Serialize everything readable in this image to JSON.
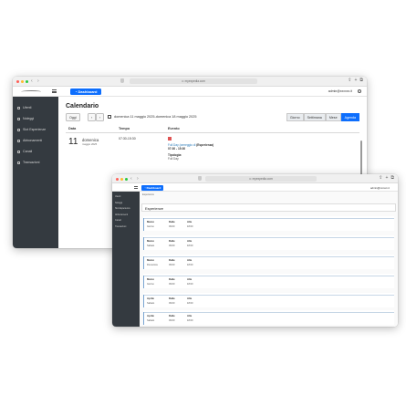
{
  "window1": {
    "url": "⊙ myexpedia.com",
    "dashboard_label": "Dashboard",
    "user_email": "admin@xxxxxx.it",
    "sidebar": [
      {
        "label": "Utenti"
      },
      {
        "label": "Noleggi"
      },
      {
        "label": "Slot Esperienze"
      },
      {
        "label": "Abbonamenti"
      },
      {
        "label": "Canali"
      },
      {
        "label": "Transazioni"
      }
    ],
    "calendar": {
      "title": "Calendario",
      "today_label": "Oggi",
      "range_text": "domenica 11 maggio 2025-domenica 18 maggio 2025",
      "views": [
        "Giorno",
        "Settimana",
        "Mese",
        "Agenda"
      ],
      "active_view": "Agenda",
      "columns": [
        "Data",
        "Tempo",
        "Evento"
      ],
      "day_number": "11",
      "day_name": "domenica",
      "day_sub": "maggio 2025",
      "time": "07:30-15:30",
      "event_link": "Full Day (ormeggio di",
      "event_rest": "(Esperienza)",
      "event_time": "07:30 - 15:30",
      "event_label": "Tipologia:",
      "event_type": "Full Day"
    }
  },
  "window2": {
    "url": "⊙ myexpedia.com",
    "dashboard_label": "Dashboard",
    "user": "admin@xxxxxx.it",
    "breadcrumb": "Esperienze",
    "card_title": "Esperienze",
    "sidebar": [
      {
        "label": "Utenti"
      },
      {
        "label": "Noleggi"
      },
      {
        "label": "Slot Esperienze"
      },
      {
        "label": "Abbonamenti"
      },
      {
        "label": "Canali"
      },
      {
        "label": "Transazioni"
      }
    ],
    "months": [
      {
        "h1": "Marzo",
        "h2": "Dalle",
        "h3": "Alle",
        "v1": "Giorno",
        "v2": "09:00",
        "v3": "18:00"
      },
      {
        "h1": "Marzo",
        "h2": "Dalle",
        "h3": "Alle",
        "v1": "Sabato",
        "v2": "09:00",
        "v3": "18:00"
      },
      {
        "h1": "Marzo",
        "h2": "Dalle",
        "h3": "Alle",
        "v1": "Domenica",
        "v2": "09:00",
        "v3": "18:00"
      },
      {
        "h1": "Marzo",
        "h2": "Dalle",
        "h3": "Alle",
        "v1": "Giorno",
        "v2": "09:00",
        "v3": "18:00"
      },
      {
        "h1": "Aprile",
        "h2": "Dalle",
        "h3": "Alle",
        "v1": "Sabato",
        "v2": "09:00",
        "v3": "18:00"
      },
      {
        "h1": "Aprile",
        "h2": "Dalle",
        "h3": "Alle",
        "v1": "Sabato",
        "v2": "09:00",
        "v3": "18:00"
      }
    ]
  }
}
